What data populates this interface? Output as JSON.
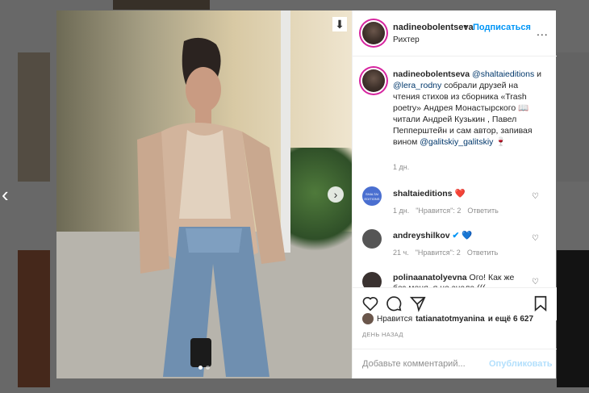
{
  "post": {
    "username": "nadineobolentseva",
    "separator": "•",
    "follow_label": "Подписаться",
    "location": "Рихтер",
    "more_label": "..."
  },
  "caption": {
    "username": "nadineobolentseva",
    "mention1": "@shaltaieditions",
    "and": "и",
    "mention2": "@lera_rodny",
    "body": "собрали друзей на чтения стихов из сборника «Trash poetry» Андрея Монастырского 📖 читали Андрей Кузькин , Павел Пепперштейн и сам автор, запивая вином",
    "mention3": "@galitskiy_galitskiy",
    "emoji": "🍷",
    "time": "1 дн."
  },
  "comments": [
    {
      "username": "shaltaieditions",
      "text": "❤️",
      "time": "1 дн.",
      "likes": "\"Нравится\": 2",
      "reply": "Ответить",
      "avatar_color": "#4a6fd0",
      "avatar_text": "SHALTAI EDITIONS"
    },
    {
      "username": "andreyshilkov",
      "text": "💙",
      "time": "21 ч.",
      "likes": "\"Нравится\": 2",
      "reply": "Ответить",
      "avatar_color": "#555555"
    },
    {
      "username": "polinaanatolyevna",
      "text": "Ого! Как же без меня. я не знала (((",
      "avatar_color": "#3a3230"
    }
  ],
  "likes": {
    "prefix": "Нравится",
    "user": "tatianatotmyanina",
    "suffix": "и ещё 6 627"
  },
  "date": "ДЕНЬ НАЗАД",
  "add_comment": {
    "placeholder": "Добавьте комментарий...",
    "publish": "Опубликовать"
  },
  "colors": {
    "accent": "#0095f6",
    "text": "#262626",
    "muted": "#8e8e8e"
  }
}
